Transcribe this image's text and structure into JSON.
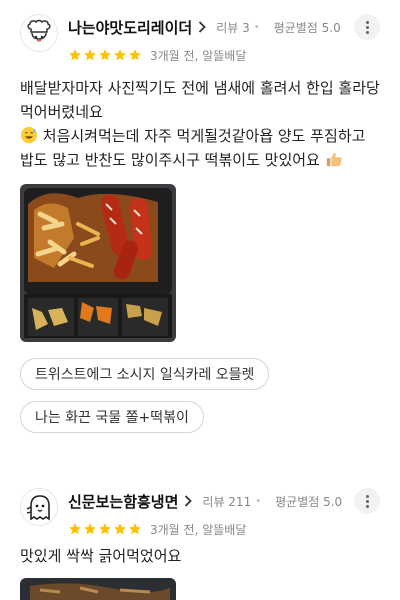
{
  "reviews": [
    {
      "nickname": "나는야맛도리레이더",
      "review_count": "리뷰 3",
      "avg_rating": "평균별점 5.0",
      "rating": 5,
      "time_and_delivery": "3개월 전, 알뜰배달",
      "text_line1": "배달받자마자 사진찍기도 전에 냄새에 홀려서 한입 홀라당 먹어버렸네요",
      "text_line2": "처음시켜먹는데 자주 먹게될것같아욥 양도 푸짐하고 밥도 많고 반찬도 많이주시구 떡볶이도 맛있어요",
      "menu_chips": [
        "트위스트에그 소시지 일식카레 오믈렛",
        "나는 화끈 국물 쫄+떡볶이"
      ],
      "icons": [
        "avatar-chef-icon",
        "chevron-right-icon",
        "more-icon",
        "star-icon",
        "sweat-smile-emoji-icon",
        "thumbs-up-emoji-icon"
      ]
    },
    {
      "nickname": "신문보는함흥냉면",
      "review_count": "리뷰 211",
      "avg_rating": "평균별점 5.0",
      "rating": 5,
      "time_and_delivery": "3개월 전, 알뜰배달",
      "text_line1": "맛있게 싹싹 긁어먹었어요",
      "icons": [
        "avatar-ghost-icon",
        "chevron-right-icon",
        "more-icon",
        "star-icon"
      ]
    }
  ],
  "colors": {
    "star": "#ffc107",
    "meta_text": "#888888",
    "chip_border": "#d5d5d5"
  }
}
